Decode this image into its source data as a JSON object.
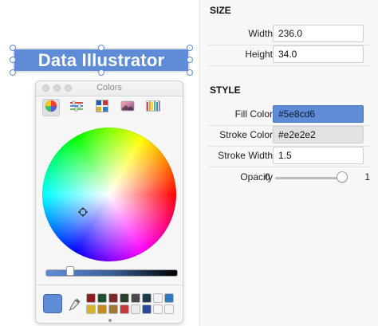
{
  "canvas": {
    "selected_text": "Data Illustrator"
  },
  "colors_panel": {
    "title": "Colors",
    "tabs": [
      {
        "name": "color-wheel",
        "active": true
      },
      {
        "name": "sliders",
        "active": false
      },
      {
        "name": "palettes",
        "active": false
      },
      {
        "name": "image-palettes",
        "active": false
      },
      {
        "name": "pencils",
        "active": false
      }
    ],
    "current_color": "#5e8cd6",
    "brightness_position": 0.18,
    "swatches": [
      "#8f1d1d",
      "#1f4f2e",
      "#7a2a2a",
      "#2a3f2c",
      "#4a4a4a",
      "#1f3b4f",
      "#f2f2f2",
      "#2f7bbf",
      "#d7b22e",
      "#c48b1a",
      "#9b7a3a",
      "#c23a3a",
      "#eaeaea",
      "#2b4a9a",
      "#f5f5f5",
      "#f5f5f5"
    ]
  },
  "properties": {
    "size": {
      "section_title": "SIZE",
      "width_label": "Width",
      "width_value": "236.0",
      "height_label": "Height",
      "height_value": "34.0"
    },
    "style": {
      "section_title": "STYLE",
      "fill_label": "Fill Color",
      "fill_value": "#5e8cd6",
      "stroke_label": "Stroke Color",
      "stroke_value": "#e2e2e2",
      "stroke_width_label": "Stroke Width",
      "stroke_width_value": "1.5",
      "opacity_label": "Opacity",
      "opacity_min": "0",
      "opacity_max": "1",
      "opacity_value": 1
    }
  }
}
